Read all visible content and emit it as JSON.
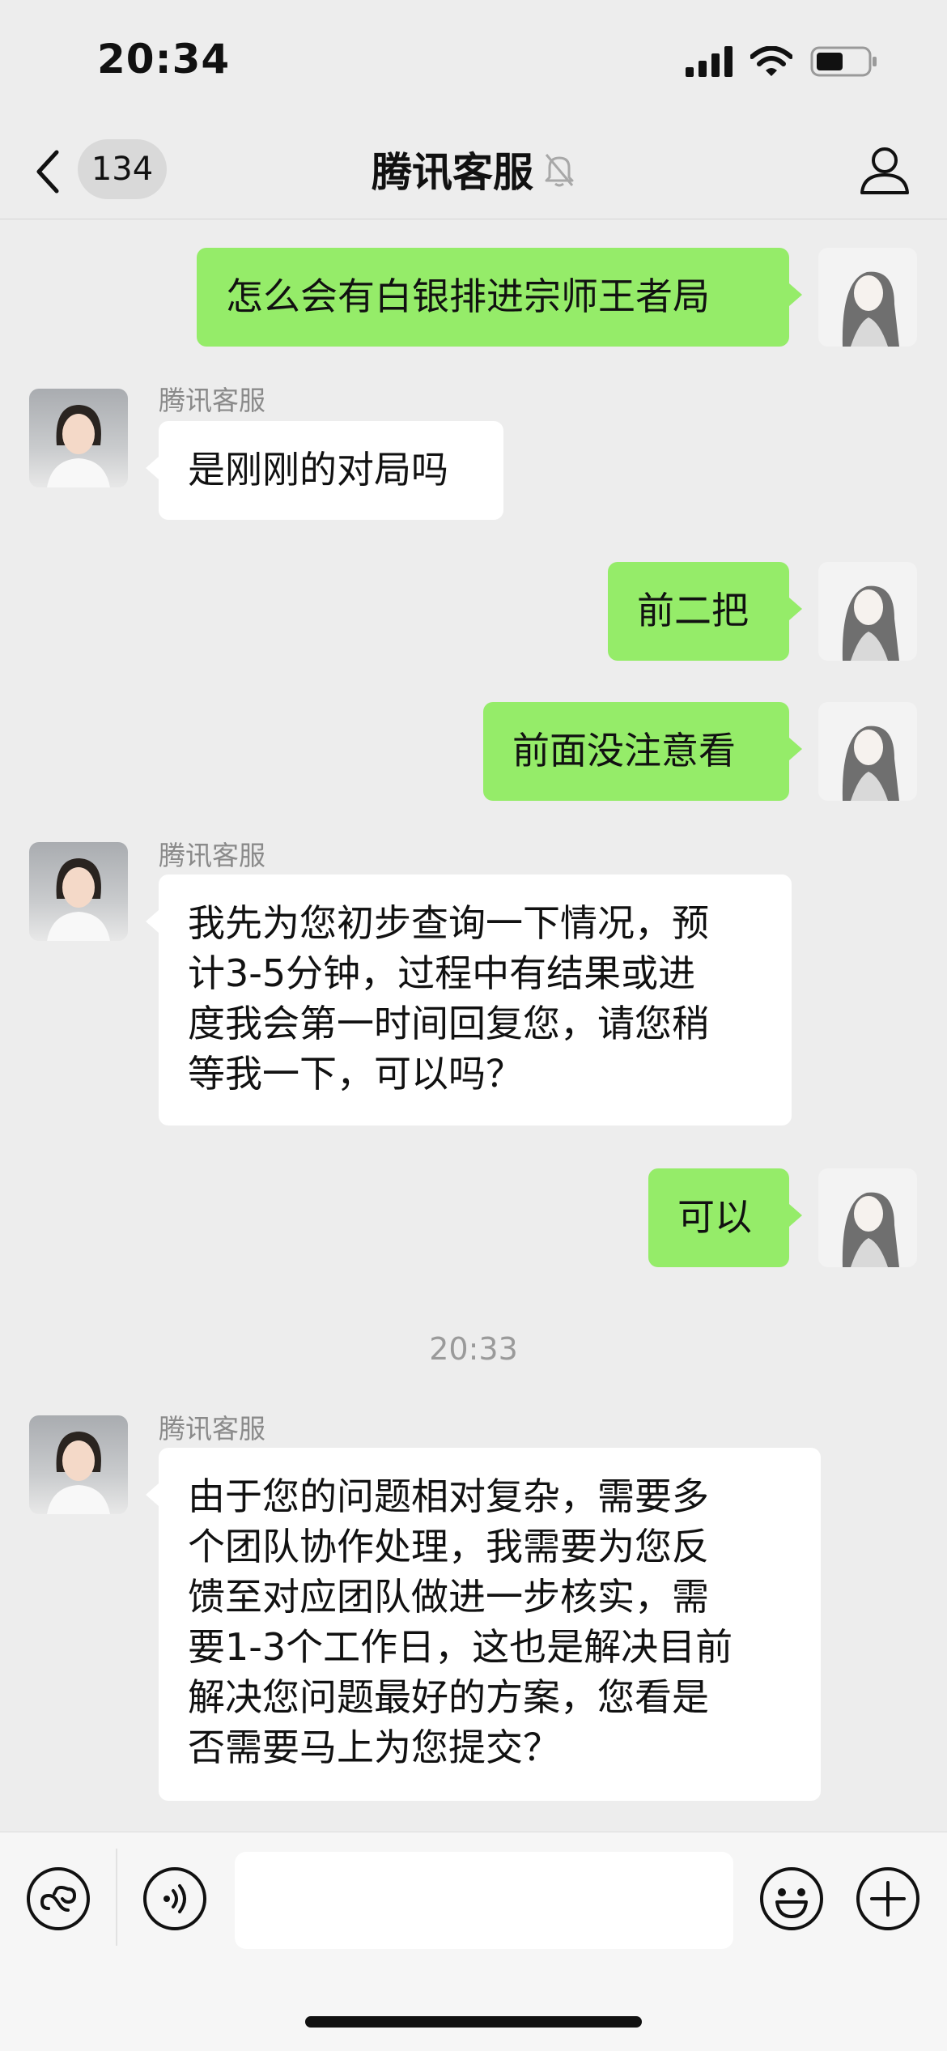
{
  "status_bar": {
    "time": "20:34"
  },
  "nav": {
    "back_count": "134",
    "title": "腾讯客服",
    "muted": true
  },
  "messages": [
    {
      "text": "怎么会有白银排进宗师王者局"
    },
    {
      "sender": "腾讯客服",
      "text": "是刚刚的对局吗"
    },
    {
      "text": "前二把"
    },
    {
      "text": "前面没注意看"
    },
    {
      "sender": "腾讯客服",
      "lines": [
        "我先为您初步查询一下情况，预",
        "计3-5分钟，过程中有结果或进",
        "度我会第一时间回复您，请您稍",
        "等我一下，可以吗？"
      ]
    },
    {
      "text": "可以"
    },
    {
      "sender": "腾讯客服",
      "lines": [
        "由于您的问题相对复杂，需要多",
        "个团队协作处理，我需要为您反",
        "馈至对应团队做进一步核实，需",
        "要1-3个工作日，这也是解决目前",
        "解决您问题最好的方案，您看是",
        "否需要马上为您提交？"
      ]
    }
  ],
  "timestamp": "20:33",
  "input": {
    "value": ""
  },
  "colors": {
    "outgoing_bubble": "#95ec69",
    "incoming_bubble": "#ffffff",
    "background": "#ededed"
  }
}
